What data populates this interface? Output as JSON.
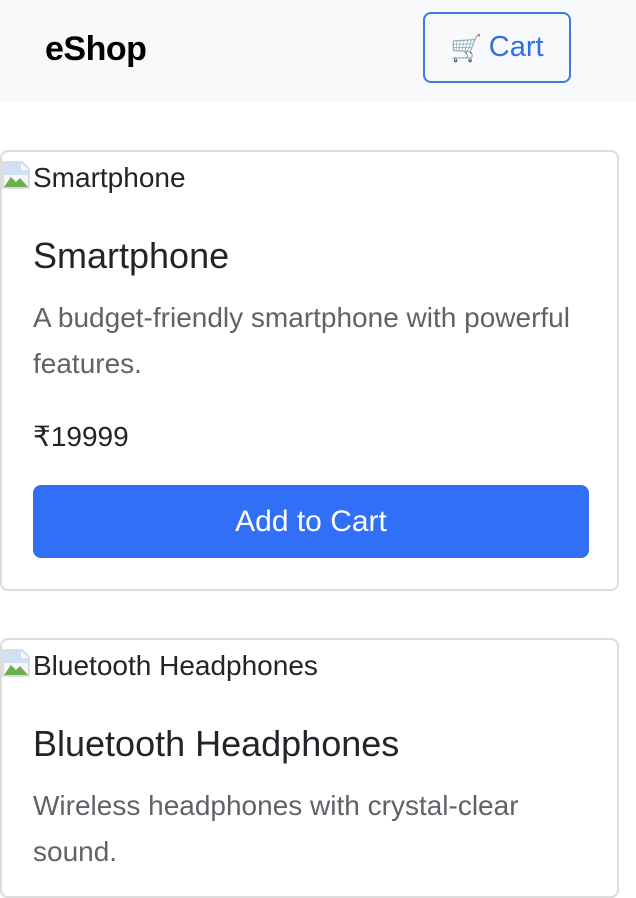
{
  "navbar": {
    "brand": "eShop",
    "cart_icon": "shopping-cart-icon",
    "cart_glyph": "🛒",
    "cart_label": "Cart"
  },
  "colors": {
    "primary": "#316ff6",
    "navbar_bg": "#f8f9fa",
    "card_border": "#dcdcdc",
    "muted_text": "#5f6368"
  },
  "products": [
    {
      "image_alt": "Smartphone",
      "name": "Smartphone",
      "description": "A budget-friendly smartphone with powerful features.",
      "price": "₹19999",
      "button_label": "Add to Cart"
    },
    {
      "image_alt": "Bluetooth Headphones",
      "name": "Bluetooth Headphones",
      "description": "Wireless headphones with crystal-clear sound."
    }
  ]
}
